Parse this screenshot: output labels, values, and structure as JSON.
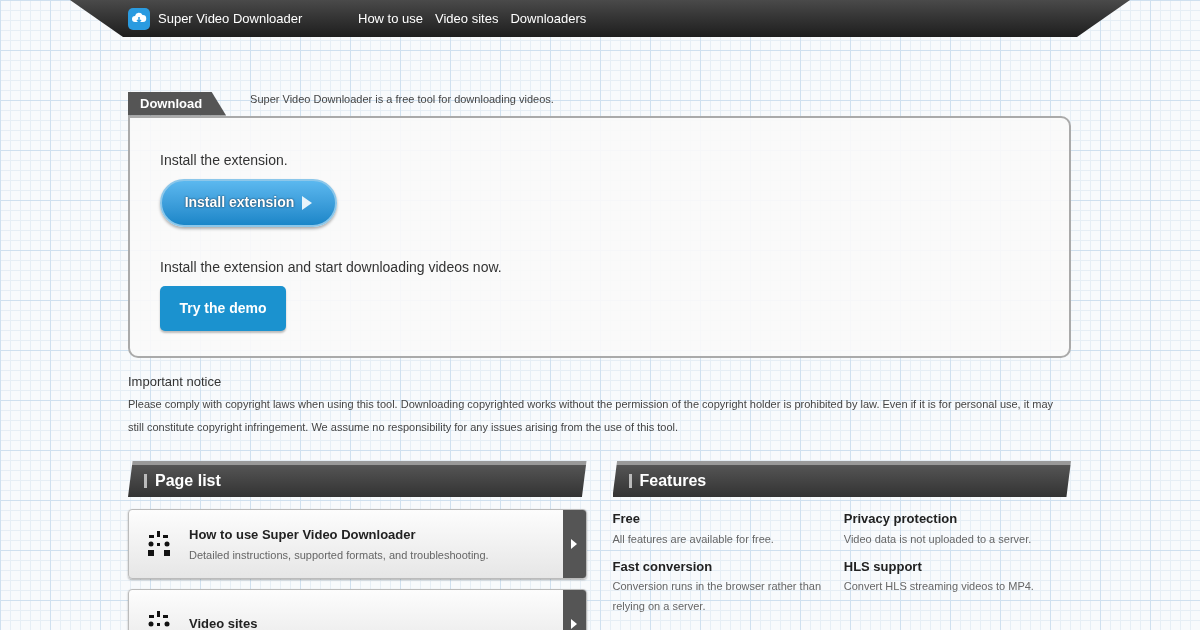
{
  "header": {
    "brand": "Super Video Downloader",
    "nav": [
      {
        "label": "How to use"
      },
      {
        "label": "Video sites"
      },
      {
        "label": "Downloaders"
      }
    ]
  },
  "download": {
    "tab": "Download",
    "tagline": "Super Video Downloader is a free tool for downloading videos.",
    "install_text": "Install the extension.",
    "install_button": "Install extension",
    "demo_text": "Install the extension and start downloading videos now.",
    "demo_button": "Try the demo"
  },
  "notice": {
    "title": "Important notice",
    "body": "Please comply with copyright laws when using this tool. Downloading copyrighted works without the permission of the copyright holder is prohibited by law. Even if it is for personal use, it may still constitute copyright infringement. We assume no responsibility for any issues arising from the use of this tool."
  },
  "page_list": {
    "heading": "Page list",
    "items": [
      {
        "title": "How to use Super Video Downloader",
        "description": "Detailed instructions, supported formats, and troubleshooting."
      },
      {
        "title": "Video sites"
      }
    ]
  },
  "features": {
    "heading": "Features",
    "items": [
      {
        "title": "Free",
        "description": "All features are available for free."
      },
      {
        "title": "Privacy protection",
        "description": "Video data is not uploaded to a server."
      },
      {
        "title": "Fast conversion",
        "description": "Conversion runs in the browser rather than relying on a server."
      },
      {
        "title": "HLS support",
        "description": "Convert HLS streaming videos to MP4."
      }
    ]
  }
}
